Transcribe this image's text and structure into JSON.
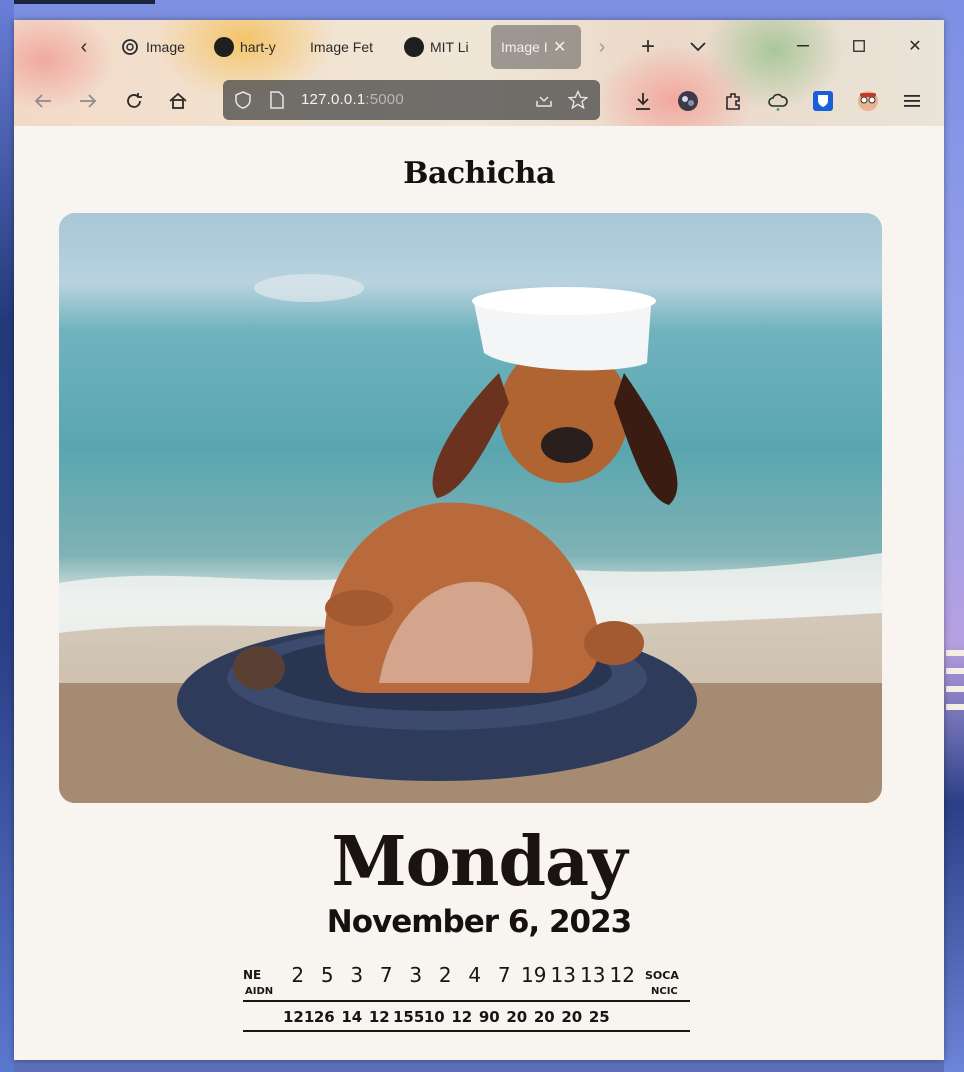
{
  "browser": {
    "tabs": [
      {
        "label": "Image",
        "icon": "openai-icon"
      },
      {
        "label": "hart-y",
        "icon": "github-icon"
      },
      {
        "label": "Image Fet",
        "icon": "none"
      },
      {
        "label": "MIT Li",
        "icon": "github-icon"
      },
      {
        "label": "Image I",
        "icon": "none",
        "active": true
      }
    ],
    "url_host": "127.0.0.1",
    "url_port": ":5000"
  },
  "page": {
    "title": "Bachicha",
    "hero_image": "dachshund-in-sailor-hat-on-beach-float",
    "day": "Monday",
    "date": "November 6, 2023"
  },
  "calendar": {
    "row1_label_top": "NE",
    "row1_label_bottom": "AIDN",
    "row1_numbers": [
      "2",
      "5",
      "3",
      "7",
      "3",
      "2",
      "4",
      "7",
      "19",
      "13",
      "13",
      "12"
    ],
    "row1_suffix_top": "SOCA",
    "row1_suffix_bottom": "NCIC",
    "row2_numbers": [
      "121",
      "26",
      "14",
      "12",
      "155",
      "10",
      "12",
      "90",
      "20",
      "20",
      "20",
      "25"
    ]
  },
  "colors": {
    "page_bg": "#f8f5f0",
    "text_dark": "#161010",
    "float_navy": "#2e3b5a"
  }
}
